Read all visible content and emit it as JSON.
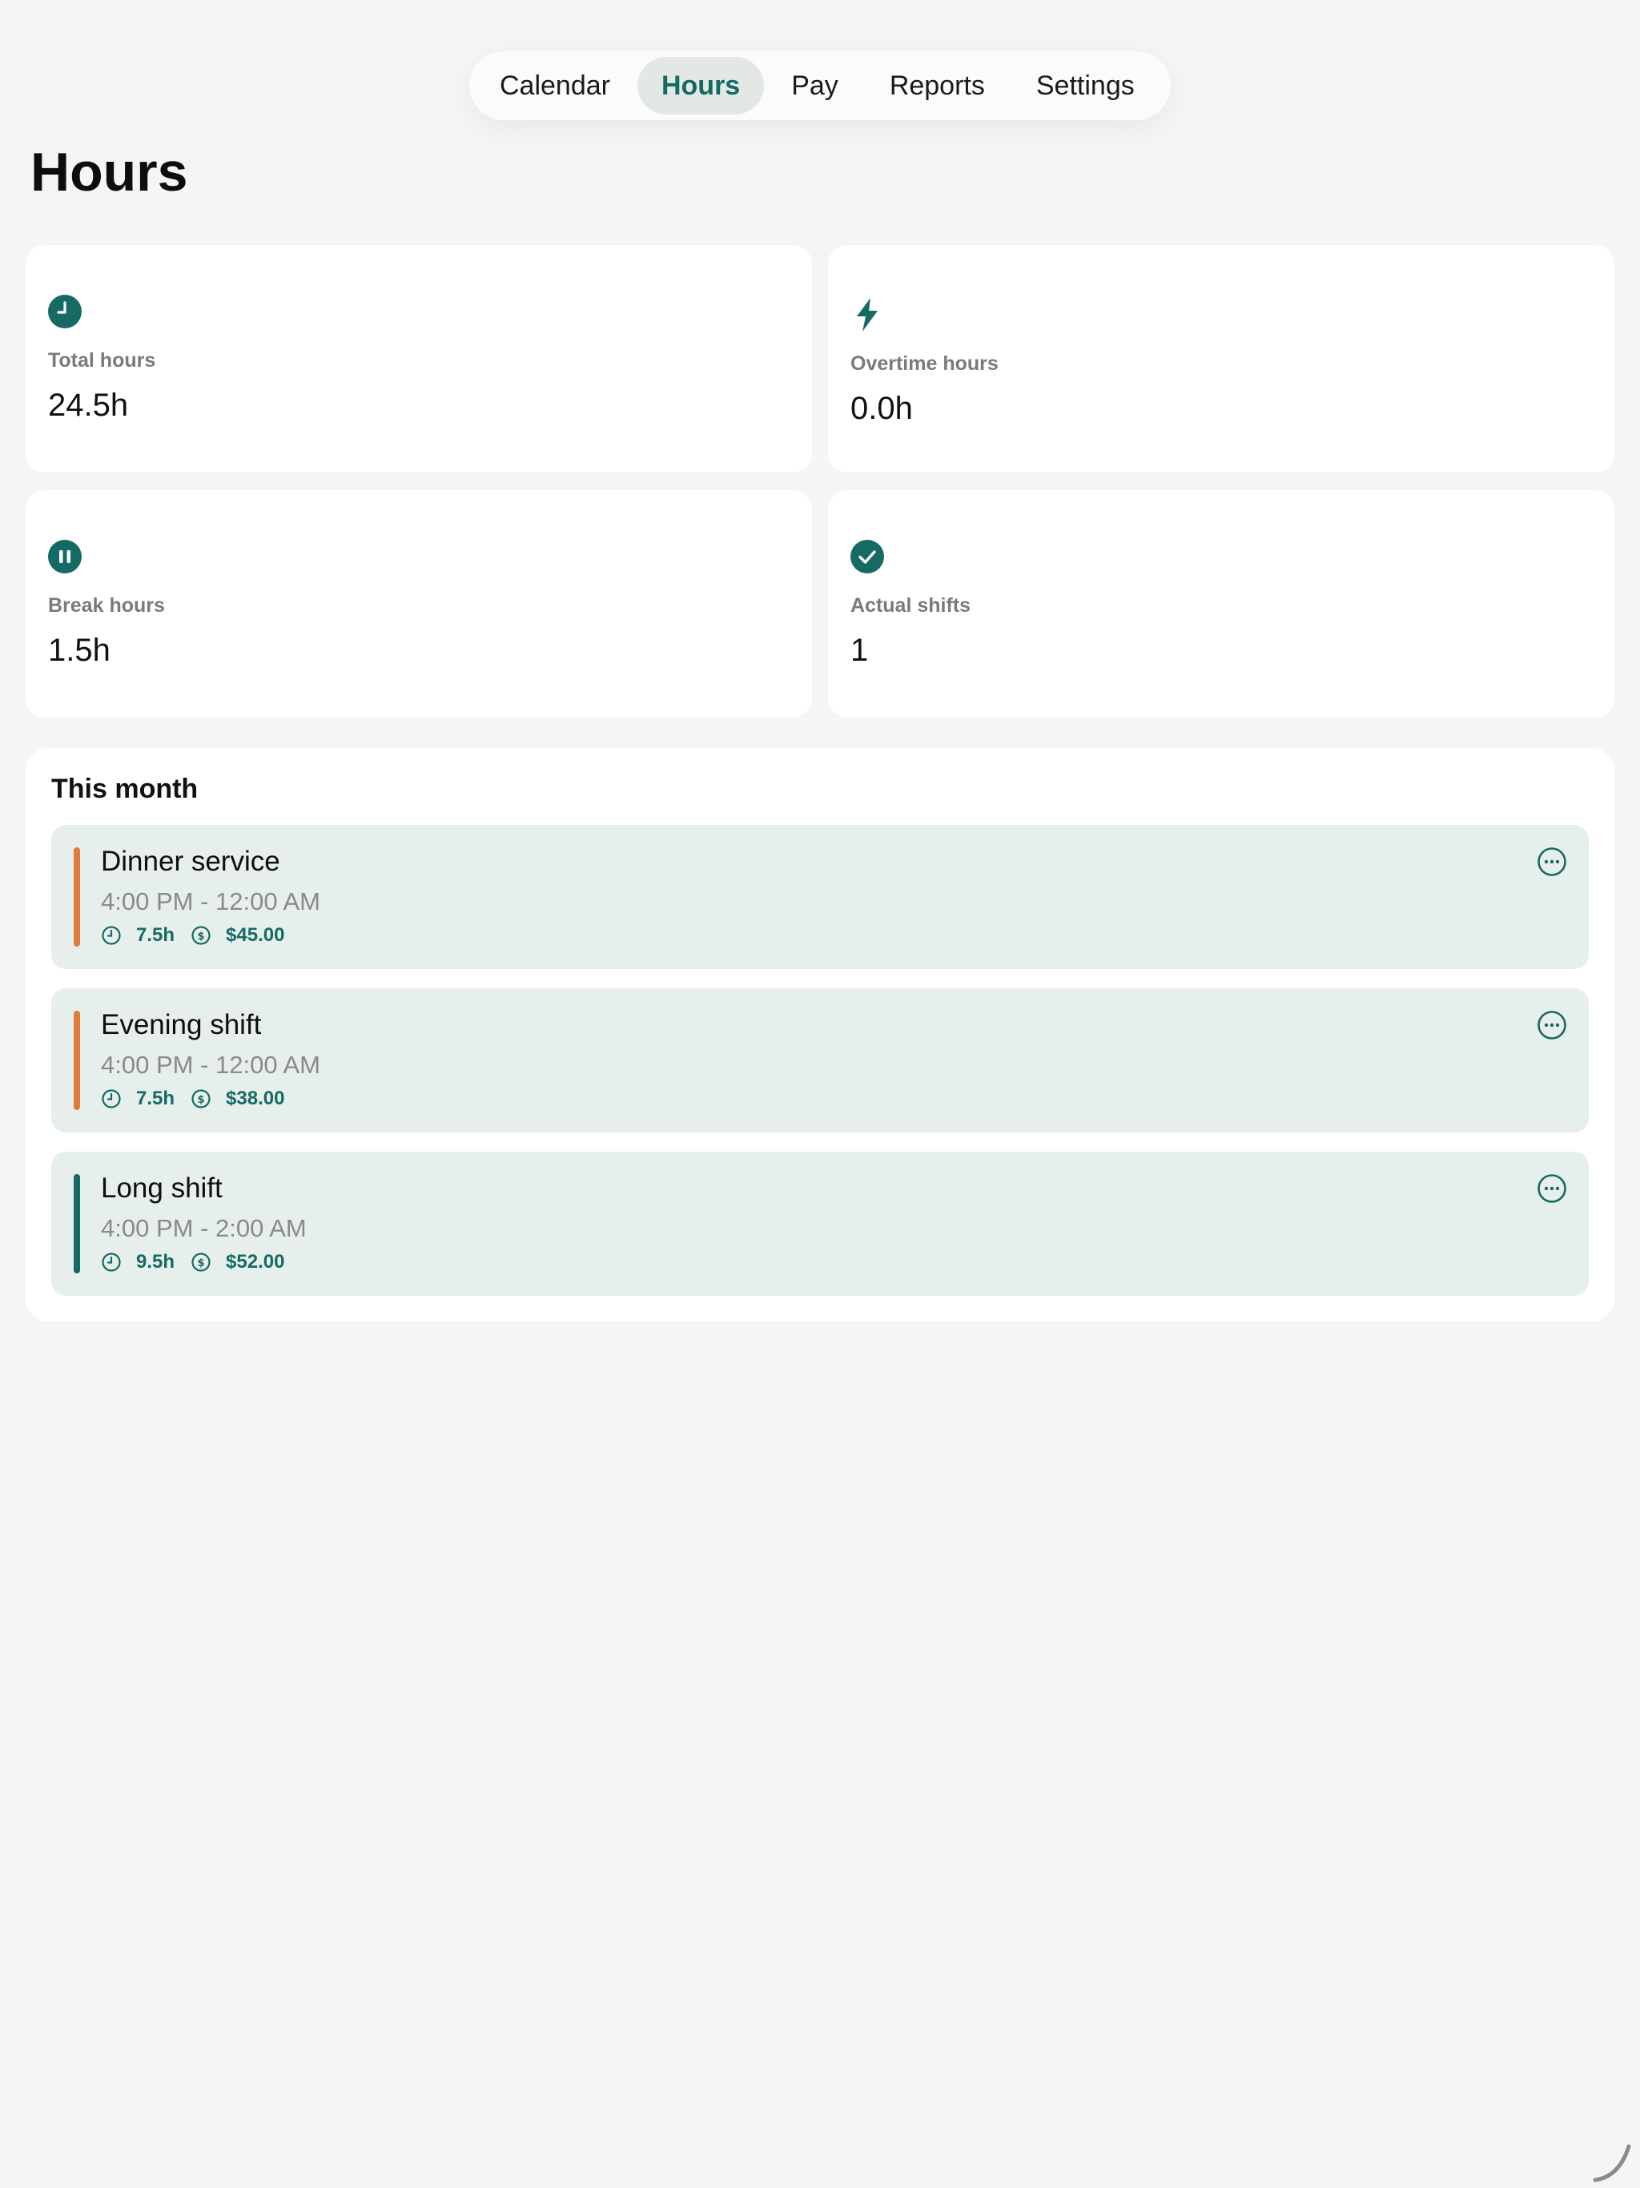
{
  "nav": {
    "tabs": [
      {
        "label": "Calendar",
        "active": false
      },
      {
        "label": "Hours",
        "active": true
      },
      {
        "label": "Pay",
        "active": false
      },
      {
        "label": "Reports",
        "active": false
      },
      {
        "label": "Settings",
        "active": false
      }
    ]
  },
  "page": {
    "title": "Hours"
  },
  "stats": [
    {
      "label": "Total hours",
      "value": "24.5h",
      "icon": "clock-icon"
    },
    {
      "label": "Overtime hours",
      "value": "0.0h",
      "icon": "lightning-icon"
    },
    {
      "label": "Break hours",
      "value": "1.5h",
      "icon": "pause-icon"
    },
    {
      "label": "Actual shifts",
      "value": "1",
      "icon": "check-icon"
    }
  ],
  "month": {
    "title": "This month",
    "shifts": [
      {
        "name": "Dinner service",
        "time": "4:00 PM - 12:00 AM",
        "hours": "7.5h",
        "pay": "$45.00",
        "color": "#e07b39"
      },
      {
        "name": "Evening shift",
        "time": "4:00 PM - 12:00 AM",
        "hours": "7.5h",
        "pay": "$38.00",
        "color": "#e07b39"
      },
      {
        "name": "Long shift",
        "time": "4:00 PM - 2:00 AM",
        "hours": "9.5h",
        "pay": "$52.00",
        "color": "#156b63"
      }
    ]
  },
  "colors": {
    "accent": "#156b63",
    "background": "#f4f6f3",
    "shift_bg": "#e7efec",
    "orange": "#e07b39"
  }
}
